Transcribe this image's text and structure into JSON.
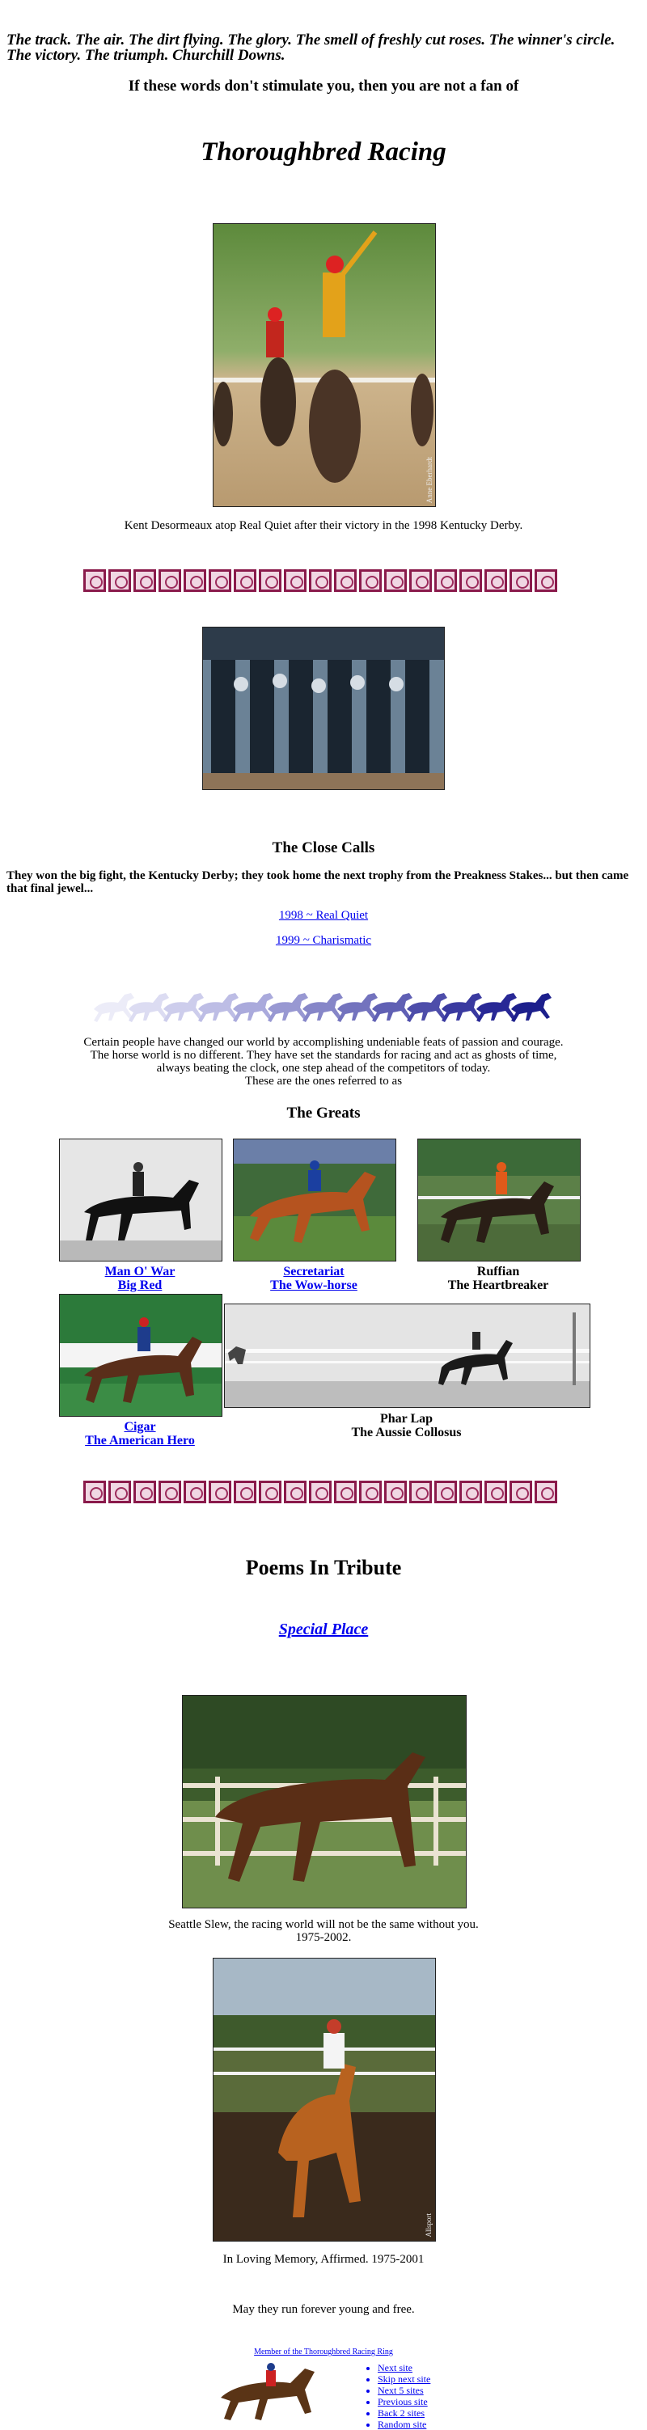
{
  "intro": {
    "text": "The track. The air. The dirt flying. The glory. The smell of freshly cut roses. The winner's circle. The victory. The triumph. Churchill Downs.",
    "stimulate": "If these words don't stimulate you, then you are not a fan of",
    "title": "Thoroughbred Racing"
  },
  "photo1": {
    "caption": "Kent Desormeaux atop Real Quiet after their victory in the 1998 Kentucky Derby.",
    "credit": "Anne Eberhardt"
  },
  "close_calls": {
    "heading": "The Close Calls",
    "text": "They won the big fight, the Kentucky Derby; they took home the next trophy from the Preakness Stakes... but then came that final jewel...",
    "links": [
      "1998 ~ Real Quiet",
      "1999 ~ Charismatic"
    ]
  },
  "greats": {
    "intro": [
      "Certain people have changed our world by accomplishing undeniable feats of passion and courage.",
      "The horse world is no different. They have set the standards for racing and act as ghosts of time,",
      "always beating the clock, one step ahead of the competitors of today.",
      "These are the ones referred to as"
    ],
    "heading": "The Greats",
    "horses": [
      {
        "name": "Man O' War",
        "nickname": "Big Red",
        "linked": true
      },
      {
        "name": "Secretariat",
        "nickname": "The Wow-horse",
        "linked": true
      },
      {
        "name": "Ruffian",
        "nickname": "The Heartbreaker",
        "linked": false
      },
      {
        "name": "Cigar",
        "nickname": "The American Hero",
        "linked": true
      },
      {
        "name": "Phar Lap",
        "nickname": "The Aussie Collosus",
        "linked": false
      }
    ]
  },
  "poems": {
    "heading": "Poems In Tribute",
    "link": "Special Place"
  },
  "tributes": {
    "slew_caption_line1": "Seattle Slew, the racing world will not be the same without you.",
    "slew_caption_line2": "1975-2002.",
    "affirmed_caption": "In Loving Memory, Affirmed. 1975-2001",
    "affirmed_credit": "Allsport",
    "closing": "May they run forever young and free."
  },
  "ring": {
    "member_text": "Member of the Thoroughbred Racing Ring",
    "links": [
      "Next site",
      "Skip next site",
      "Next 5 sites",
      "Previous site",
      "Back 2 sites",
      "Random site"
    ]
  },
  "colors": {
    "link": "#0000ee",
    "knot_border": "#8a1a4b",
    "horse_dark": "#1c1f8c",
    "horse_light": "#e4e4f6"
  }
}
